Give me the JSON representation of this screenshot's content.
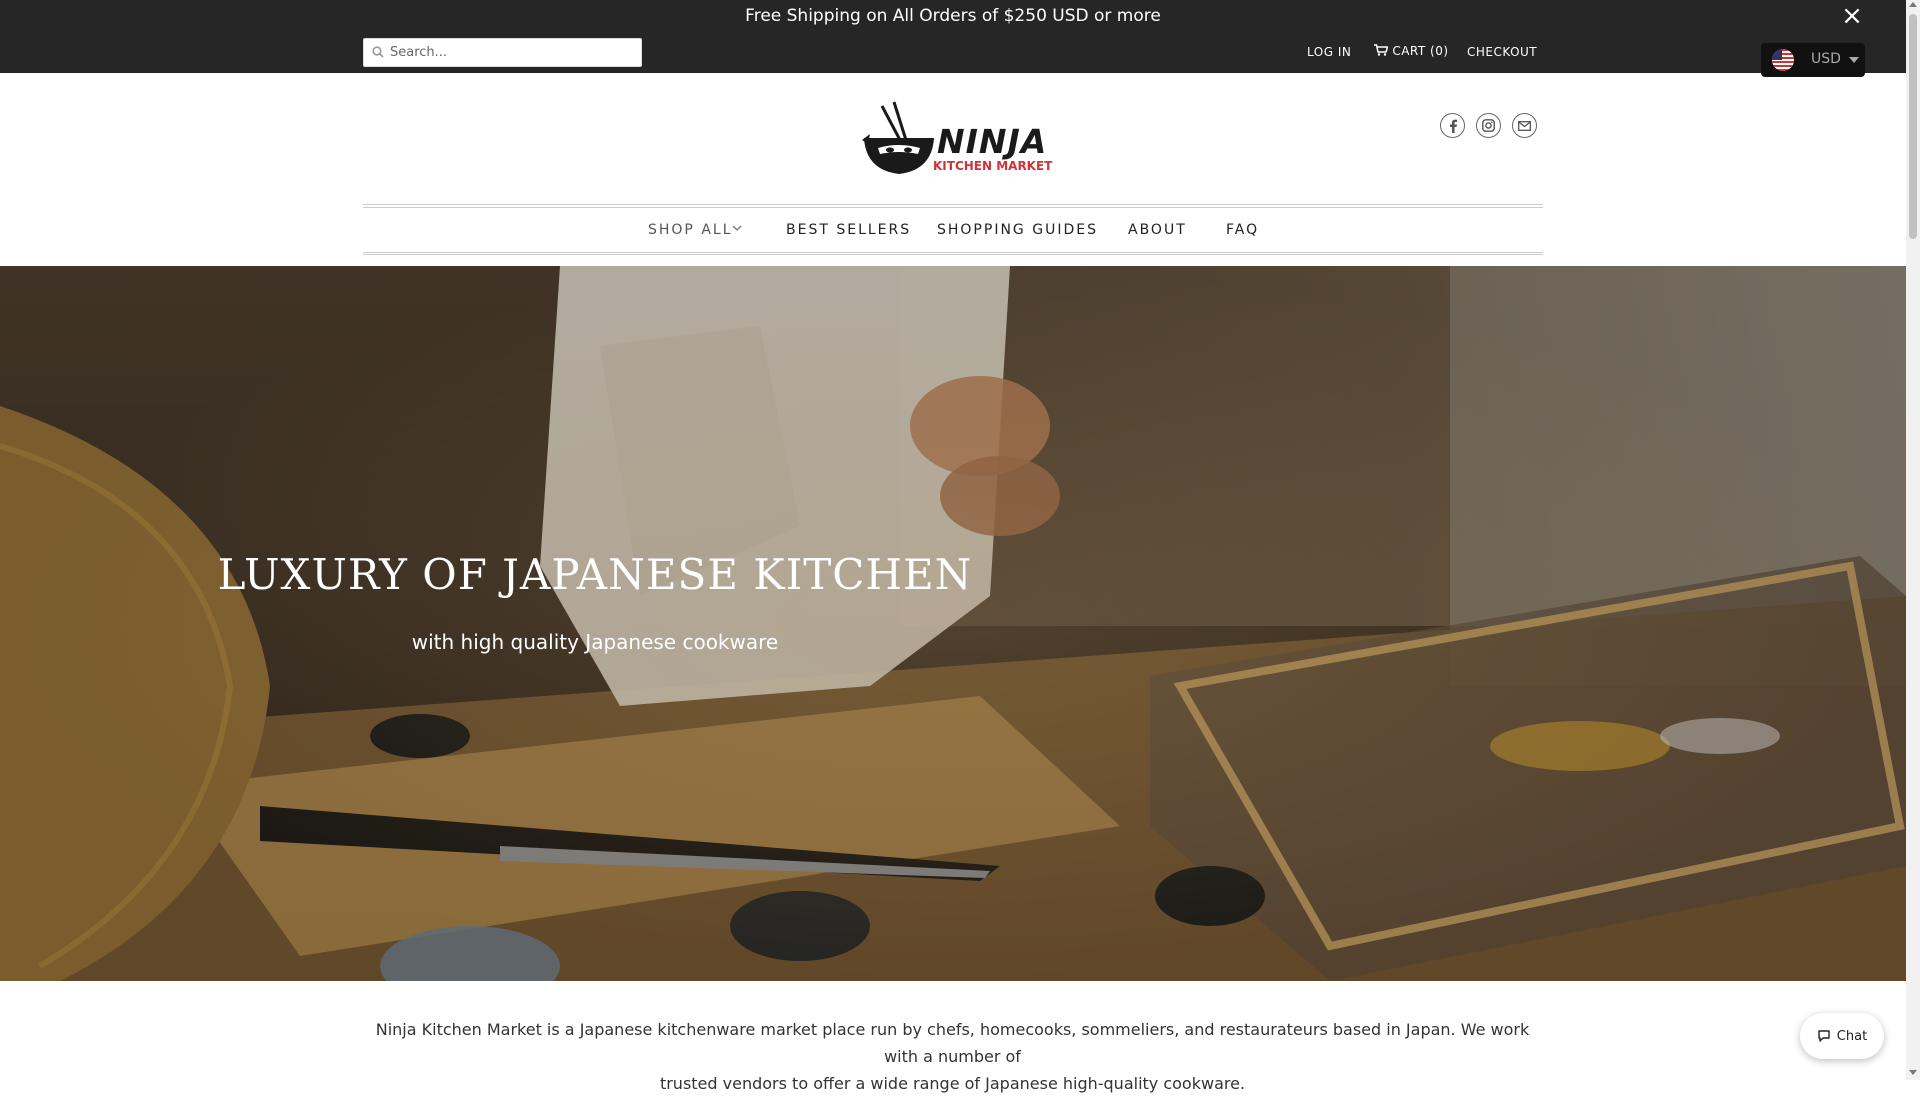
{
  "announcement": {
    "text": "Free Shipping on All Orders of $250 USD or more",
    "close_label": "×"
  },
  "header": {
    "search_placeholder": "Search...",
    "log_in": "LOG IN",
    "cart": "CART (0)",
    "checkout": "CHECKOUT",
    "currency": "USD"
  },
  "logo": {
    "main": "NINJA",
    "sub": "KITCHEN MARKET"
  },
  "social": [
    "facebook-icon",
    "instagram-icon",
    "email-icon"
  ],
  "nav": {
    "items": [
      "SHOP ALL",
      "BEST SELLERS",
      "SHOPPING GUIDES",
      "ABOUT",
      "FAQ"
    ]
  },
  "hero": {
    "title": "LUXURY OF JAPANESE KITCHEN",
    "subtitle": "with high quality Japanese cookware"
  },
  "about": {
    "line1": "Ninja Kitchen Market is a Japanese kitchenware market place run by chefs, homecooks, sommeliers, and restaurateurs based in Japan. We work with a number of",
    "line2": "trusted vendors to offer a wide range of Japanese high-quality cookware."
  },
  "chat": {
    "label": "Chat"
  },
  "colors": {
    "topbar": "#262626",
    "accent_red": "#d0343a",
    "text": "#333333"
  }
}
